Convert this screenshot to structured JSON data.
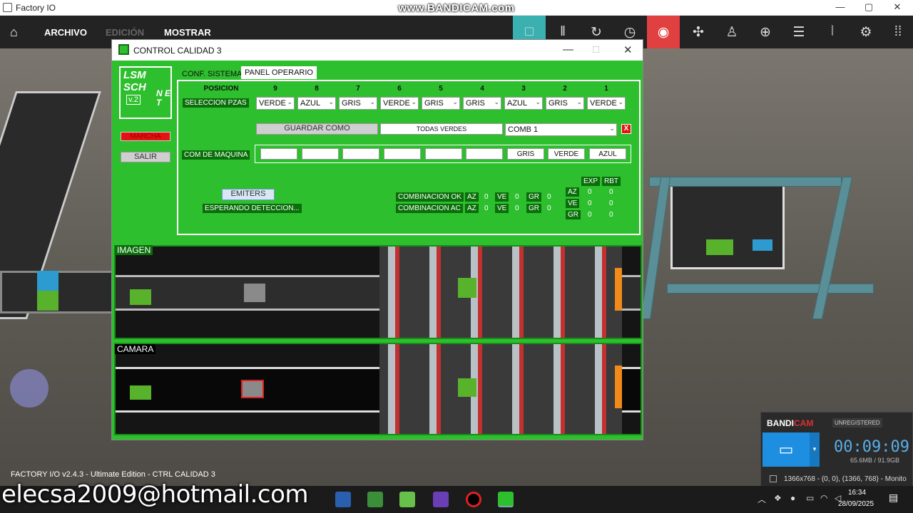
{
  "os": {
    "window_title": "Factory IO",
    "minimize": "—",
    "maximize": "▢",
    "close": "✕"
  },
  "watermark": "www.BANDICAM.com",
  "app_menu": [
    {
      "label": "ARCHIVO"
    },
    {
      "label": "EDICIÓN",
      "disabled": true
    },
    {
      "label": "MOSTRAR"
    }
  ],
  "toolbar_icons": [
    "stop-icon",
    "pause-icon",
    "reset-icon",
    "timer-icon",
    "sensor-icon",
    "fan-icon",
    "person-icon",
    "target-icon",
    "list-icon",
    "drivers-icon",
    "gears-icon",
    "grid-icon"
  ],
  "dialog": {
    "title": "CONTROL CALIDAD 3",
    "logo": {
      "line1": "LSM SCH",
      "version": "v.2",
      "net": "N E T"
    },
    "btn_red": "MARCHA",
    "btn_exit": "SALIR",
    "tabs": [
      {
        "label": "CONF. SISTEMA",
        "active": false
      },
      {
        "label": "PANEL OPERARIO",
        "active": true
      }
    ],
    "pos_label": "POSICION",
    "sel_label": "SELECCION PZAS",
    "positions": [
      "9",
      "8",
      "7",
      "6",
      "5",
      "4",
      "3",
      "2",
      "1"
    ],
    "selections": [
      "VERDE",
      "AZUL",
      "GRIS",
      "VERDE",
      "GRIS",
      "GRIS",
      "AZUL",
      "GRIS",
      "VERDE"
    ],
    "save_as": "GUARDAR COMO",
    "name_field": "TODAS VERDES",
    "combo_select": "COMB 1",
    "close_x": "X",
    "machine_label": "COM DE MAQUINA",
    "machine_values": [
      "",
      "",
      "",
      "",
      "",
      "",
      "GRIS",
      "VERDE",
      "AZUL"
    ],
    "emiters": "EMITERS",
    "waiting": "ESPERANDO DETECCION...",
    "combo_ok": "COMBINACION OK",
    "combo_ac": "COMBINACION AC",
    "counts_ok": [
      {
        "tag": "AZ",
        "val": "0"
      },
      {
        "tag": "VE",
        "val": "0"
      },
      {
        "tag": "GR",
        "val": "0"
      }
    ],
    "counts_ac": [
      {
        "tag": "AZ",
        "val": "0"
      },
      {
        "tag": "VE",
        "val": "0"
      },
      {
        "tag": "GR",
        "val": "0"
      }
    ],
    "exp_header": "EXP",
    "rbt_header": "RBT",
    "exp_rbt_rows": [
      {
        "tag": "AZ",
        "exp": "0",
        "rbt": "0"
      },
      {
        "tag": "VE",
        "exp": "0",
        "rbt": "0"
      },
      {
        "tag": "GR",
        "exp": "0",
        "rbt": "0"
      }
    ],
    "view_image": "IMAGEN",
    "view_camera": "CAMARA"
  },
  "status_bar": "FACTORY I/O v2.4.3 - Ultimate Edition - CTRL CALIDAD 3",
  "email": "elecsa2009@hotmail.com",
  "bandicam": {
    "brand": "BANDI",
    "brand2": "CAM",
    "unregistered": "UNREGISTERED",
    "timer": "00:09:09",
    "size": "65.6MB / 91.9GB",
    "resolution": "1366x768 - (0, 0), (1366, 768) - Monito"
  },
  "taskbar": {
    "time": "16:34",
    "date": "28/09/2025"
  }
}
